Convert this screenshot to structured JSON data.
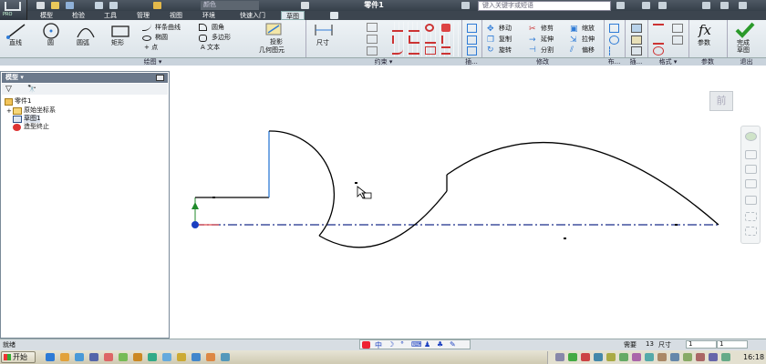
{
  "app": {
    "badge": "PRO",
    "window_title": "零件1",
    "search_placeholder": "键入关键字或短语",
    "quick_access_value": "颜色"
  },
  "tabs": [
    "模型",
    "检验",
    "工具",
    "管理",
    "视图",
    "环境",
    "快速入门",
    "草图"
  ],
  "active_tab": "草图",
  "ribbon": {
    "draw": {
      "line": "直线",
      "circle": "圆",
      "arc": "圆弧",
      "rect": "矩形",
      "spline": "样条曲线",
      "ellipse": "椭圆",
      "point": "+ 点",
      "fillet": "圆角",
      "polygon": "多边形",
      "text": "A 文本"
    },
    "project": {
      "label1": "投影",
      "label2": "几何图元"
    },
    "constrain": {
      "dimension": "尺寸"
    },
    "modify": {
      "move": "移动",
      "trim": "修剪",
      "scale": "缩放",
      "copy": "复制",
      "extend": "延伸",
      "stretch": "拉伸",
      "rotate": "旋转",
      "split": "分割",
      "offset": "偏移"
    },
    "param": {
      "label": "参数"
    },
    "finish": {
      "label1": "完成",
      "label2": "草图"
    }
  },
  "groups": {
    "draw": "绘图 ▾",
    "constrain": "约束 ▾",
    "insert": "插...",
    "modify": "修改",
    "pattern": "布...",
    "insert2": "插...",
    "format": "格式 ▾",
    "param": "参数",
    "exit": "退出"
  },
  "panel": {
    "title": "模型 ▾",
    "tree": [
      "零件1",
      "原始坐标系",
      "草图1",
      "造型终止"
    ]
  },
  "viewcube_label": "前",
  "status": {
    "ready": "就绪",
    "need_label": "需要",
    "need_value": "13",
    "dim_label": "尺寸",
    "box1": "1",
    "box2": "1"
  },
  "taskbar": {
    "start": "开始",
    "clock": "16:18"
  },
  "colors": {
    "accent": "#2e7bd6",
    "axis": "#1a2f8a",
    "sketch": "#000000"
  }
}
